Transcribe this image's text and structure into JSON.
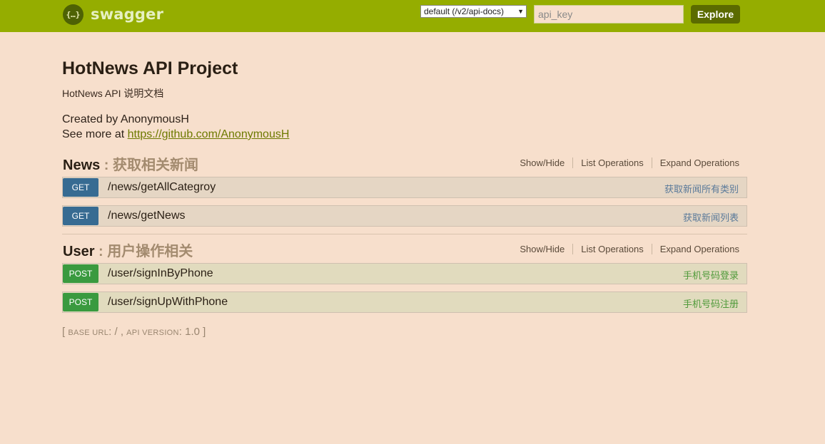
{
  "header": {
    "logo_icon": "{…}",
    "logo_text": "swagger",
    "spec_select": "default (/v2/api-docs)",
    "api_key_placeholder": "api_key",
    "explore_label": "Explore"
  },
  "info": {
    "title": "HotNews API Project",
    "description": "HotNews API 说明文档",
    "created_by": "Created by AnonymousH",
    "see_more_prefix": "See more at ",
    "see_more_link": "https://github.com/AnonymousH"
  },
  "resources": [
    {
      "name": "News",
      "separator": " : ",
      "description": "获取相关新闻",
      "show_hide": "Show/Hide",
      "list_ops": "List Operations",
      "expand_ops": "Expand Operations",
      "operations": [
        {
          "method": "GET",
          "path": "/news/getAllCategroy",
          "summary": "获取新闻所有类别"
        },
        {
          "method": "GET",
          "path": "/news/getNews",
          "summary": "获取新闻列表"
        }
      ]
    },
    {
      "name": "User",
      "separator": " : ",
      "description": "用户操作相关",
      "show_hide": "Show/Hide",
      "list_ops": "List Operations",
      "expand_ops": "Expand Operations",
      "operations": [
        {
          "method": "POST",
          "path": "/user/signInByPhone",
          "summary": "手机号码登录"
        },
        {
          "method": "POST",
          "path": "/user/signUpWithPhone",
          "summary": "手机号码注册"
        }
      ]
    }
  ],
  "footer": {
    "open_bracket": "[ ",
    "base_url_label": "BASE URL",
    "base_url_value": ": / , ",
    "api_version_label": "API VERSION",
    "api_version_value": ": 1.0 ]"
  },
  "colors": {
    "header_bg": "#95ad00",
    "page_bg": "#f7dfcc",
    "get_badge": "#376b92",
    "post_badge": "#3a9a3f",
    "explore_btn": "#5b6b00"
  }
}
